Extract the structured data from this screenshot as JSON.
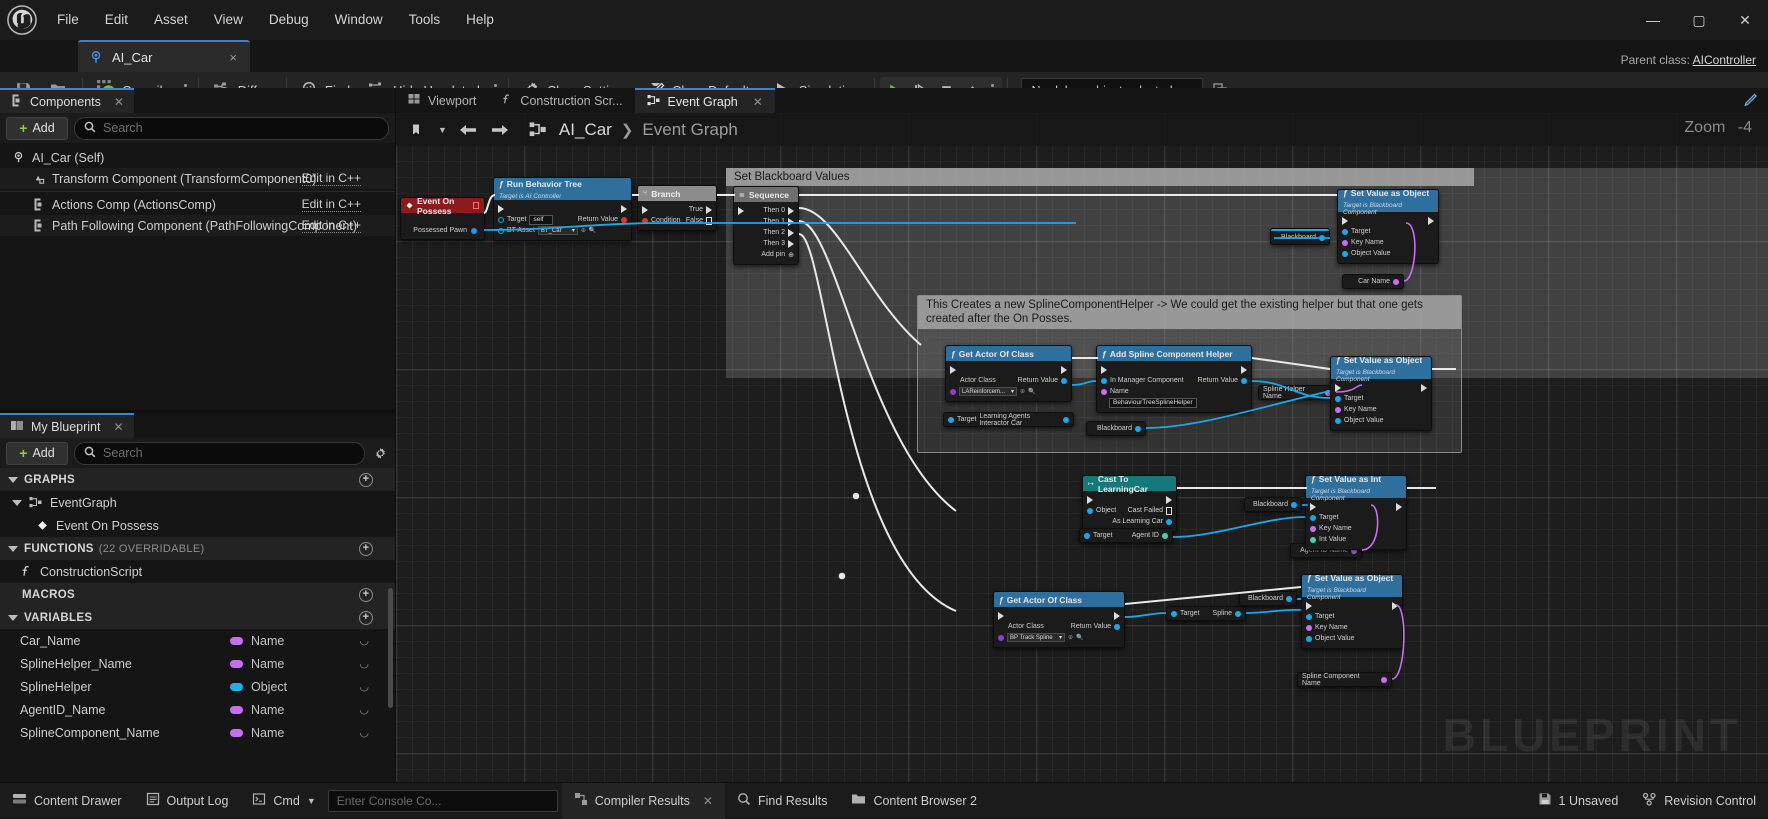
{
  "window": {
    "logo_icon": "unreal-engine-logo",
    "menus": [
      "File",
      "Edit",
      "Asset",
      "View",
      "Debug",
      "Window",
      "Tools",
      "Help"
    ],
    "controls": {
      "minimize": "minimize-icon",
      "maximize": "maximize-icon",
      "close": "close-icon"
    }
  },
  "asset_tab": {
    "icon": "blueprint-class-icon",
    "label": "AI_Car",
    "close": "×"
  },
  "parent_class": {
    "label": "Parent class:",
    "value": "AIController"
  },
  "toolbar": {
    "save_icon": "save-icon",
    "browse_icon": "browse-content-icon",
    "compile_label": "Compile",
    "compile_icon": "compile-check-icon",
    "diff_label": "Diff",
    "diff_icon": "diff-icon",
    "find_label": "Find",
    "find_icon": "search-icon",
    "hide_unrelated_label": "Hide Unrelated",
    "hide_unrelated_icon": "hide-unrelated-eye-icon",
    "class_settings_label": "Class Settings",
    "class_settings_icon": "gear-icon",
    "class_defaults_label": "Class Defaults",
    "class_defaults_icon": "pencil-icon",
    "simulation_label": "Simulation",
    "simulation_icon": "simulation-icon",
    "play_icon": "play-icon",
    "step_icon": "step-icon",
    "stop_icon": "stop-icon",
    "eject_icon": "eject-icon",
    "debug_object": "No debug object selected",
    "debug_extra_icon": "debug-filter-icon"
  },
  "components_panel": {
    "tab_label": "Components",
    "tab_icon": "components-icon",
    "add_label": "Add",
    "search_placeholder": "Search",
    "rows": [
      {
        "label": "AI_Car (Self)",
        "icon": "blueprint-self-icon",
        "edit": "",
        "indent": 0
      },
      {
        "label": "Transform Component (TransformComponent0)",
        "icon": "transform-icon",
        "edit": "Edit in C++",
        "indent": 1
      },
      {
        "label": "Actions Comp (ActionsComp)",
        "icon": "component-icon",
        "edit": "Edit in C++",
        "indent": 1
      },
      {
        "label": "Path Following Component (PathFollowingComponent)",
        "icon": "component-icon",
        "edit": "Edit in C++",
        "indent": 1
      }
    ]
  },
  "my_blueprint_panel": {
    "tab_label": "My Blueprint",
    "tab_icon": "book-icon",
    "add_label": "Add",
    "search_placeholder": "Search",
    "sections": {
      "graphs_label": "GRAPHS",
      "functions_label": "FUNCTIONS",
      "functions_count": "(22 OVERRIDABLE)",
      "macros_label": "MACROS",
      "variables_label": "VARIABLES"
    },
    "graphs": [
      {
        "label": "EventGraph",
        "icon": "event-graph-icon"
      },
      {
        "label": "Event On Possess",
        "icon": "event-node-icon"
      }
    ],
    "functions": [
      {
        "label": "ConstructionScript",
        "icon": "function-icon"
      }
    ],
    "variables": [
      {
        "name": "Car_Name",
        "type": "Name",
        "color": "#c86ef0"
      },
      {
        "name": "SplineHelper_Name",
        "type": "Name",
        "color": "#c86ef0"
      },
      {
        "name": "SplineHelper",
        "type": "Object",
        "color": "#20b0ea"
      },
      {
        "name": "AgentID_Name",
        "type": "Name",
        "color": "#c86ef0"
      },
      {
        "name": "SplineComponent_Name",
        "type": "Name",
        "color": "#c86ef0"
      }
    ]
  },
  "graph_tabs": [
    {
      "label": "Viewport",
      "icon": "viewport-icon",
      "active": false,
      "closable": false
    },
    {
      "label": "Construction Scr...",
      "icon": "function-icon",
      "active": false,
      "closable": false
    },
    {
      "label": "Event Graph",
      "icon": "event-graph-icon",
      "active": true,
      "closable": true
    }
  ],
  "graph_header": {
    "bookmark_icon": "bookmark-icon",
    "back_icon": "arrow-left-icon",
    "forward_icon": "arrow-right-icon",
    "graph_icon": "event-graph-icon",
    "breadcrumb_root": "AI_Car",
    "breadcrumb_sep": "❯",
    "breadcrumb_current": "Event Graph",
    "zoom_label": "Zoom",
    "zoom_value": "-4",
    "watermark": "BLUEPRINT"
  },
  "comments": [
    {
      "title": "Set Blackboard Values"
    },
    {
      "title": "This Creates a new SplineComponentHelper -> We could get the existing helper but that one gets created after the On Posses."
    }
  ],
  "nodes": [
    {
      "id": "event_on_possess",
      "title": "Event On Possess",
      "subtitle": "",
      "kind": "event",
      "pins": [
        {
          "label": "Possessed Pawn",
          "side": "out",
          "color": "#2196f3"
        }
      ]
    },
    {
      "id": "run_behavior_tree",
      "title": "Run Behavior Tree",
      "subtitle": "Target is AI Controller",
      "kind": "function",
      "pins": [
        {
          "label": "Target",
          "side": "in",
          "color": "#1ea7e8",
          "value": "self"
        },
        {
          "label": "BT Asset",
          "side": "in",
          "color": "#1ea7e8",
          "value": "BT_Car"
        },
        {
          "label": "Return Value",
          "side": "out",
          "color": "#e03434"
        }
      ]
    },
    {
      "id": "branch",
      "title": "Branch",
      "subtitle": "",
      "kind": "flow",
      "pins": [
        {
          "label": "Condition",
          "side": "in",
          "color": "#e03434"
        },
        {
          "label": "True",
          "side": "out"
        },
        {
          "label": "False",
          "side": "out"
        }
      ]
    },
    {
      "id": "sequence",
      "title": "Sequence",
      "subtitle": "",
      "kind": "flow",
      "pins": [
        {
          "label": "Then 0",
          "side": "out"
        },
        {
          "label": "Then 1",
          "side": "out"
        },
        {
          "label": "Then 2",
          "side": "out"
        },
        {
          "label": "Then 3",
          "side": "out"
        },
        {
          "label": "Add pin",
          "side": "out"
        }
      ]
    },
    {
      "id": "set_value_as_object_1",
      "title": "Set Value as Object",
      "subtitle": "Target is Blackboard Component",
      "kind": "function",
      "pins": [
        {
          "label": "Target",
          "side": "in",
          "color": "#1ea7e8"
        },
        {
          "label": "Key Name",
          "side": "in",
          "color": "#c86ef0"
        },
        {
          "label": "Object Value",
          "side": "in",
          "color": "#1ea7e8"
        }
      ]
    },
    {
      "id": "blackboard_1",
      "title": "Blackboard",
      "subtitle": "",
      "kind": "var",
      "pins": []
    },
    {
      "id": "car_name_var",
      "title": "Car Name",
      "subtitle": "",
      "kind": "var",
      "pins": []
    },
    {
      "id": "get_actor_of_class_1",
      "title": "Get Actor Of Class",
      "subtitle": "",
      "kind": "function",
      "pins": [
        {
          "label": "Actor Class",
          "side": "in",
          "color": "#c86ef0",
          "value": "LAReinforcem..."
        },
        {
          "label": "Return Value",
          "side": "out",
          "color": "#1ea7e8"
        }
      ]
    },
    {
      "id": "add_spline_component_helper",
      "title": "Add Spline Component Helper",
      "subtitle": "",
      "kind": "function",
      "pins": [
        {
          "label": "In Manager Component",
          "side": "in",
          "color": "#1ea7e8"
        },
        {
          "label": "Name",
          "side": "in",
          "color": "#c86ef0",
          "value": "BehaviourTreeSplineHelper"
        },
        {
          "label": "Return Value",
          "side": "out",
          "color": "#1ea7e8"
        }
      ]
    },
    {
      "id": "target_lai_car",
      "title": "Learning Agents Interactor Car",
      "subtitle": "",
      "kind": "var",
      "pins": [
        {
          "label": "Target",
          "side": "in",
          "color": "#1ea7e8"
        }
      ]
    },
    {
      "id": "spline_helper_name_var",
      "title": "Spline Helper Name",
      "subtitle": "",
      "kind": "var",
      "pins": []
    },
    {
      "id": "blackboard_2",
      "title": "Blackboard",
      "subtitle": "",
      "kind": "var",
      "pins": []
    },
    {
      "id": "set_value_as_object_2",
      "title": "Set Value as Object",
      "subtitle": "Target is Blackboard Component",
      "kind": "function",
      "pins": [
        {
          "label": "Target",
          "side": "in",
          "color": "#1ea7e8"
        },
        {
          "label": "Key Name",
          "side": "in",
          "color": "#c86ef0"
        },
        {
          "label": "Object Value",
          "side": "in",
          "color": "#1ea7e8"
        }
      ]
    },
    {
      "id": "cast_to_learning_car",
      "title": "Cast To LearningCar",
      "subtitle": "",
      "kind": "cast",
      "pins": [
        {
          "label": "Object",
          "side": "in",
          "color": "#1ea7e8"
        },
        {
          "label": "Cast Failed",
          "side": "out"
        },
        {
          "label": "As Learning Car",
          "side": "out",
          "color": "#1ea7e8"
        }
      ]
    },
    {
      "id": "agent_id_get",
      "title": "Agent ID",
      "subtitle": "",
      "kind": "var",
      "pins": [
        {
          "label": "Target",
          "side": "in",
          "color": "#1ea7e8"
        },
        {
          "label": "Agent ID",
          "side": "out",
          "color": "#4dd0b0"
        }
      ]
    },
    {
      "id": "set_value_as_int",
      "title": "Set Value as Int",
      "subtitle": "Target is Blackboard Component",
      "kind": "function",
      "pins": [
        {
          "label": "Target",
          "side": "in",
          "color": "#1ea7e8"
        },
        {
          "label": "Key Name",
          "side": "in",
          "color": "#c86ef0"
        },
        {
          "label": "Int Value",
          "side": "in",
          "color": "#4dd0b0"
        }
      ]
    },
    {
      "id": "blackboard_3",
      "title": "Blackboard",
      "subtitle": "",
      "kind": "var",
      "pins": []
    },
    {
      "id": "agent_id_name_var",
      "title": "Agent ID Name",
      "subtitle": "",
      "kind": "var",
      "pins": []
    },
    {
      "id": "get_actor_of_class_2",
      "title": "Get Actor Of Class",
      "subtitle": "",
      "kind": "function",
      "pins": [
        {
          "label": "Actor Class",
          "side": "in",
          "color": "#c86ef0",
          "value": "BP Track Spline"
        },
        {
          "label": "Return Value",
          "side": "out",
          "color": "#1ea7e8"
        }
      ]
    },
    {
      "id": "spline_get",
      "title": "Spline",
      "subtitle": "",
      "kind": "var",
      "pins": [
        {
          "label": "Target",
          "side": "in",
          "color": "#1ea7e8"
        },
        {
          "label": "Spline",
          "side": "out",
          "color": "#1ea7e8"
        }
      ]
    },
    {
      "id": "blackboard_4",
      "title": "Blackboard",
      "subtitle": "",
      "kind": "var",
      "pins": []
    },
    {
      "id": "set_value_as_object_3",
      "title": "Set Value as Object",
      "subtitle": "Target is Blackboard Component",
      "kind": "function",
      "pins": [
        {
          "label": "Target",
          "side": "in",
          "color": "#1ea7e8"
        },
        {
          "label": "Key Name",
          "side": "in",
          "color": "#c86ef0"
        },
        {
          "label": "Object Value",
          "side": "in",
          "color": "#1ea7e8"
        }
      ]
    },
    {
      "id": "spline_component_name_var",
      "title": "Spline Component Name",
      "subtitle": "",
      "kind": "var",
      "pins": []
    }
  ],
  "bottom_bar": {
    "content_drawer": {
      "label": "Content Drawer",
      "icon": "drawer-icon"
    },
    "output_log": {
      "label": "Output Log",
      "icon": "log-icon"
    },
    "cmd": {
      "label": "Cmd",
      "icon": "cmd-icon"
    },
    "console_placeholder": "Enter Console Co...",
    "compiler_results": {
      "label": "Compiler Results",
      "icon": "compiler-icon"
    },
    "find_results": {
      "label": "Find Results",
      "icon": "search-icon"
    },
    "content_browser": {
      "label": "Content Browser 2",
      "icon": "content-browser-icon"
    },
    "unsaved": {
      "label": "1 Unsaved",
      "icon": "save-icon"
    },
    "revision": {
      "label": "Revision Control",
      "icon": "revision-control-icon"
    }
  }
}
